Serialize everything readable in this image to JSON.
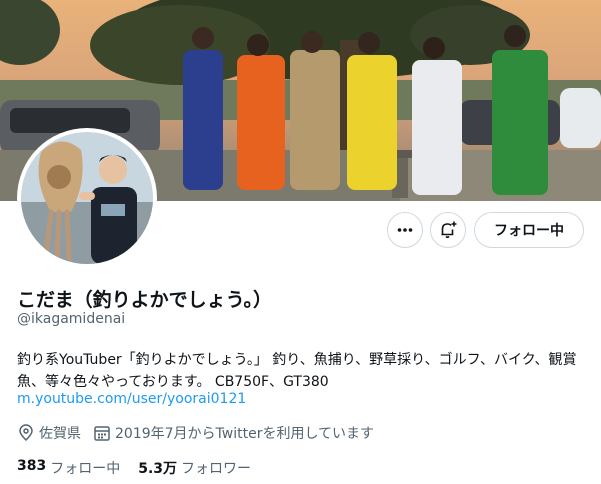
{
  "profile": {
    "display_name": "こだま（釣りよかでしょう。）",
    "handle": "@ikagamidenai",
    "bio": "釣り系YouTuber「釣りよかでしょう。」 釣り、魚捕り、野草採り、ゴルフ、バイク、観賞魚、等々色々やっております。 CB750F、GT380",
    "link": "m.youtube.com/user/yoorai0121",
    "location": "佐賀県",
    "joined": "2019年7月からTwitterを利用しています"
  },
  "actions": {
    "more_icon": "more-horizontal-icon",
    "notify_icon": "bell-plus-icon",
    "follow_label": "フォロー中"
  },
  "stats": {
    "following_count": "383",
    "following_label": "フォロー中",
    "followers_count": "5.3万",
    "followers_label": "フォロワー"
  },
  "colors": {
    "link": "#1d9bf0",
    "secondary_text": "#536471",
    "border": "#cfd9de"
  }
}
